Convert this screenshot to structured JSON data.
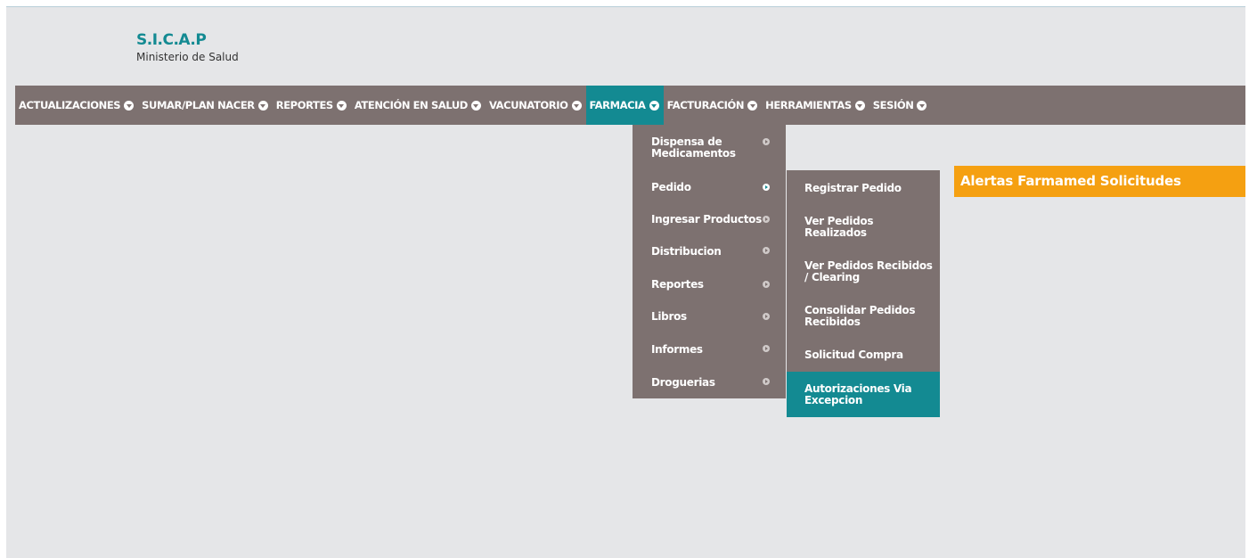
{
  "brand": {
    "title": "S.I.C.A.P",
    "subtitle": "Ministerio de Salud"
  },
  "menu": [
    {
      "label": "ACTUALIZACIONES"
    },
    {
      "label": "SUMAR/PLAN NACER"
    },
    {
      "label": "REPORTES"
    },
    {
      "label": "ATENCIÓN EN SALUD"
    },
    {
      "label": "VACUNATORIO"
    },
    {
      "label": "FARMACIA",
      "active": true
    },
    {
      "label": "FACTURACIÓN"
    },
    {
      "label": "HERRAMIENTAS"
    },
    {
      "label": "SESIÓN"
    }
  ],
  "farmacia_menu": [
    {
      "label": "Dispensa de\nMedicamentos"
    },
    {
      "label": "Pedido",
      "active": true
    },
    {
      "label": "Ingresar Productos"
    },
    {
      "label": "Distribucion"
    },
    {
      "label": "Reportes"
    },
    {
      "label": "Libros"
    },
    {
      "label": "Informes"
    },
    {
      "label": "Droguerias"
    }
  ],
  "pedido_menu": [
    {
      "label": "Registrar Pedido"
    },
    {
      "label": "Ver Pedidos\nRealizados"
    },
    {
      "label": "Ver Pedidos Recibidos\n/ Clearing"
    },
    {
      "label": "Consolidar Pedidos\nRecibidos"
    },
    {
      "label": "Solicitud Compra"
    },
    {
      "label": "Autorizaciones Via\nExcepcion",
      "selected": true
    }
  ],
  "alert": {
    "label": "Alertas Farmamed Solicitudes"
  },
  "colors": {
    "menu_bg": "#7d7170",
    "accent": "#138a92",
    "alert": "#f5a011",
    "page_bg": "#e5e6e8"
  }
}
